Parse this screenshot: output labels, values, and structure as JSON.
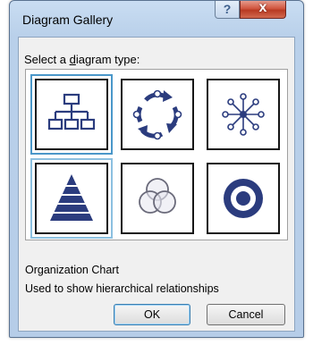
{
  "window": {
    "title": "Diagram Gallery",
    "help_glyph": "?",
    "close_glyph": "x"
  },
  "prompt": {
    "before": "Select a ",
    "underlined": "d",
    "after": "iagram type:"
  },
  "gallery": {
    "selected_index": 0,
    "items": [
      {
        "icon": "organization-chart-icon"
      },
      {
        "icon": "cycle-diagram-icon"
      },
      {
        "icon": "radial-diagram-icon"
      },
      {
        "icon": "pyramid-diagram-icon"
      },
      {
        "icon": "venn-diagram-icon"
      },
      {
        "icon": "target-diagram-icon"
      }
    ]
  },
  "description": {
    "name": "Organization Chart",
    "text": "Used to show hierarchical relationships"
  },
  "buttons": {
    "ok": "OK",
    "cancel": "Cancel"
  },
  "colors": {
    "icon_navy": "#2b3c7e",
    "selection": "#4a97c9",
    "close_red": "#c8452e"
  }
}
